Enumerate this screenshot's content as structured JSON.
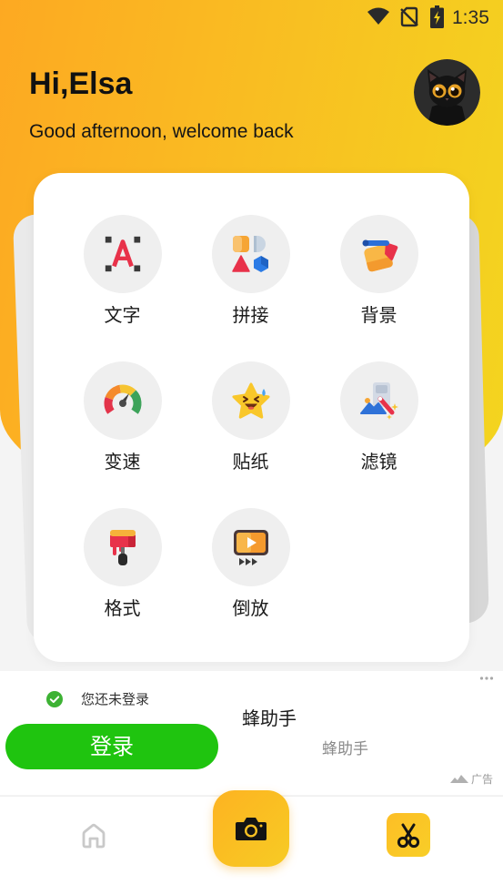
{
  "status_bar": {
    "time": "1:35",
    "icons": [
      "wifi-icon",
      "no-sim-icon",
      "battery-charging-icon"
    ]
  },
  "header": {
    "greeting": "Hi,Elsa",
    "subtitle": "Good afternoon, welcome back",
    "avatar_icon": "black-cat-avatar"
  },
  "tools": [
    {
      "label": "文字",
      "icon": "text-icon"
    },
    {
      "label": "拼接",
      "icon": "collage-icon"
    },
    {
      "label": "背景",
      "icon": "background-icon"
    },
    {
      "label": "变速",
      "icon": "speed-gauge-icon"
    },
    {
      "label": "贴纸",
      "icon": "sticker-icon"
    },
    {
      "label": "滤镜",
      "icon": "filter-icon"
    },
    {
      "label": "格式",
      "icon": "format-icon"
    },
    {
      "label": "倒放",
      "icon": "reverse-play-icon"
    }
  ],
  "ad": {
    "login_notice": "您还未登录",
    "title": "蜂助手",
    "login_button": "登录",
    "subtitle": "蜂助手",
    "ad_label": "广告",
    "icons": [
      "check-circle-icon",
      "more-icon",
      "ad-logo-icon"
    ]
  },
  "bottom_nav": {
    "items": [
      {
        "icon": "home-icon"
      },
      {
        "icon": "camera-icon"
      },
      {
        "icon": "scissors-icon"
      }
    ]
  },
  "colors": {
    "header_gradient_start": "#FDA922",
    "header_gradient_end": "#F3D51F",
    "login_button": "#1FC40F",
    "check_green": "#3DB234",
    "accent_yellow": "#FBC22A"
  }
}
